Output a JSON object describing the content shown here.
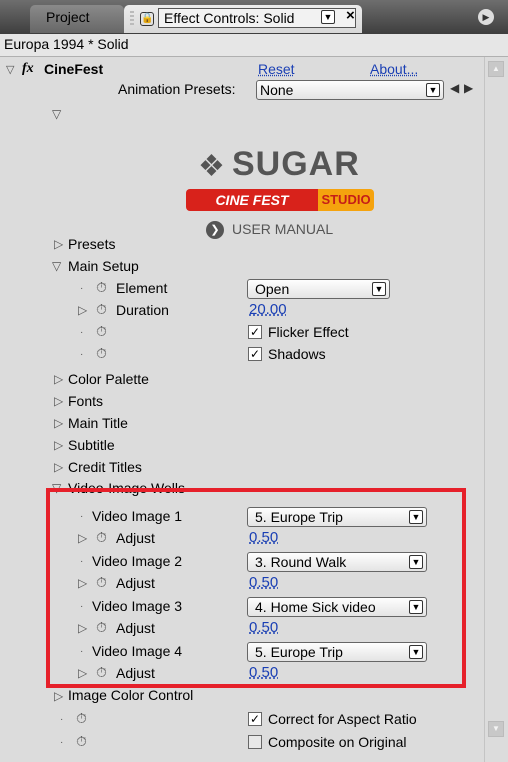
{
  "tabs": {
    "project": "Project",
    "effect_controls": "Effect Controls: Solid"
  },
  "composition_title": "Europa 1994 * Solid",
  "effect": {
    "icon": "fx",
    "name": "CineFest",
    "reset": "Reset",
    "about": "About..."
  },
  "animation_presets": {
    "label": "Animation Presets:",
    "value": "None"
  },
  "logo": {
    "brand": "SUGAR",
    "product": "CINE FEST",
    "studio": "STUDIO",
    "manual": "USER MANUAL"
  },
  "rows": {
    "presets": "Presets",
    "main_setup": "Main Setup",
    "element_label": "Element",
    "element_value": "Open",
    "duration_label": "Duration",
    "duration_value": "20.00",
    "flicker": "Flicker Effect",
    "shadows": "Shadows",
    "color_palette": "Color Palette",
    "fonts": "Fonts",
    "main_title": "Main Title",
    "subtitle": "Subtitle",
    "credit_titles": "Credit Titles",
    "video_wells": "Video-Image Wells",
    "image_color_control": "Image Color Control",
    "aspect": "Correct for Aspect Ratio",
    "composite": "Composite on Original"
  },
  "video_images": [
    {
      "label": "Video Image 1",
      "value": "5. Europe Trip",
      "adjust_label": "Adjust",
      "adjust_value": "0.50"
    },
    {
      "label": "Video Image 2",
      "value": "3. Round Walk",
      "adjust_label": "Adjust",
      "adjust_value": "0.50"
    },
    {
      "label": "Video Image 3",
      "value": "4. Home Sick video",
      "adjust_label": "Adjust",
      "adjust_value": "0.50"
    },
    {
      "label": "Video Image 4",
      "value": "5. Europe Trip",
      "adjust_label": "Adjust",
      "adjust_value": "0.50"
    }
  ],
  "checks": {
    "flicker": true,
    "shadows": true,
    "aspect": true,
    "composite": false
  },
  "colors": {
    "highlight_box": "#e6202a",
    "link_blue": "#1a3fb4"
  }
}
